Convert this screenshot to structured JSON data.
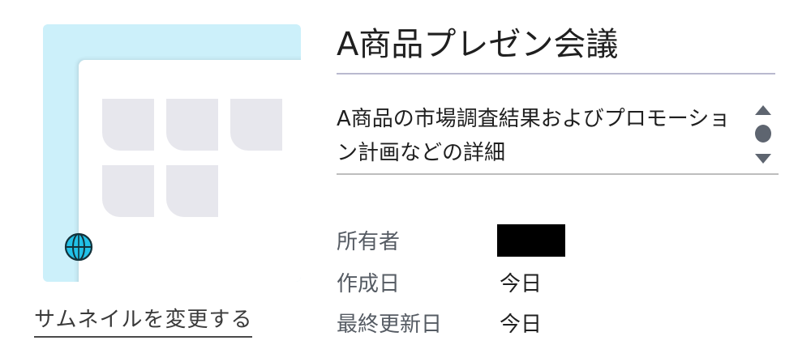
{
  "thumbnail": {
    "change_link": "サムネイルを変更する",
    "bg_color": "#ccf0fa",
    "globe_icon": "globe-icon"
  },
  "presentation": {
    "title": "A商品プレゼン会議",
    "description": "A商品の市場調査結果およびプロモーション計画などの詳細"
  },
  "details": {
    "owner_label": "所有者",
    "owner_value": "",
    "created_label": "作成日",
    "created_value": "今日",
    "updated_label": "最終更新日",
    "updated_value": "今日"
  }
}
